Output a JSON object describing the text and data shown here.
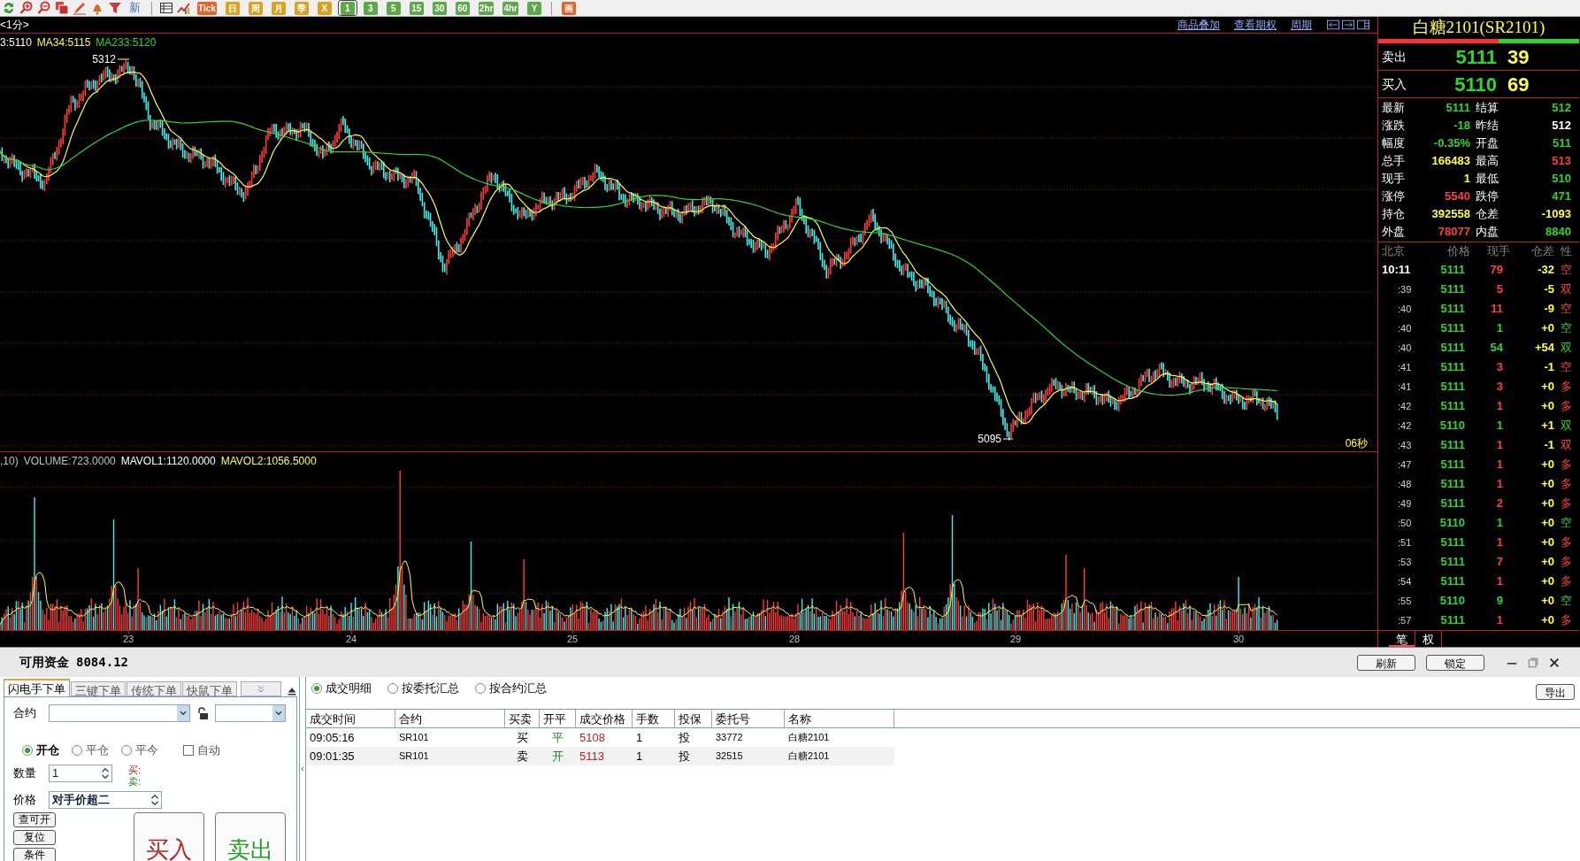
{
  "toolbar": {
    "text_label": "新",
    "tiles": [
      {
        "label": "Tick",
        "color": "#e5632b",
        "selected": false
      },
      {
        "label": "日",
        "color": "#d9a21f",
        "selected": false
      },
      {
        "label": "周",
        "color": "#d9a21f",
        "selected": false
      },
      {
        "label": "月",
        "color": "#d9a21f",
        "selected": false
      },
      {
        "label": "季",
        "color": "#d9a21f",
        "selected": false
      },
      {
        "label": "X",
        "color": "#d9a21f",
        "selected": false
      },
      {
        "label": "1",
        "color": "#5fa84a",
        "selected": true
      },
      {
        "label": "3",
        "color": "#5fa84a",
        "selected": false
      },
      {
        "label": "5",
        "color": "#5fa84a",
        "selected": false
      },
      {
        "label": "15",
        "color": "#5fa84a",
        "selected": false
      },
      {
        "label": "30",
        "color": "#5fa84a",
        "selected": false
      },
      {
        "label": "60",
        "color": "#5fa84a",
        "selected": false
      },
      {
        "label": "2hr",
        "color": "#5fa84a",
        "selected": false
      },
      {
        "label": "4hr",
        "color": "#5fa84a",
        "selected": false
      },
      {
        "label": "Y",
        "color": "#5fa84a",
        "selected": false
      }
    ],
    "end_tiles": [
      {
        "label": "画",
        "color": "#e5632b",
        "selected": false
      }
    ]
  },
  "chart": {
    "period": "<1分>",
    "links": [
      "商品叠加",
      "查看期权",
      "周期"
    ],
    "ma_legend": [
      {
        "text": "3:5110",
        "color": "#ffffff"
      },
      {
        "text": "MA34:5115",
        "color": "#ffff3c"
      },
      {
        "text": "MA233:5120",
        "color": "#2fd52f"
      }
    ],
    "high_label": "5312",
    "low_label": "5095",
    "countdown": "06秒",
    "volume_legend": [
      {
        "text": ",10)",
        "color": "#c0c0c0"
      },
      {
        "text": "VOLUME:723.0000",
        "color": "#c0c0c0"
      },
      {
        "text": "MAVOL1:1120.0000",
        "color": "#ffffff"
      },
      {
        "text": "MAVOL2:1056.5000",
        "color": "#ffff3c"
      }
    ],
    "dates": [
      "23",
      "24",
      "25",
      "28",
      "29",
      "30"
    ]
  },
  "quote": {
    "title": "白糖2101(SR2101)",
    "level": 0.6,
    "ask": {
      "label": "卖出",
      "price": "5111",
      "volume": "39"
    },
    "bid": {
      "label": "买入",
      "price": "5110",
      "volume": "69"
    },
    "stats": [
      {
        "label": "最新",
        "value": "5111",
        "color": "#2fd52f"
      },
      {
        "label": "结算",
        "value": "512",
        "color": "#2fd52f"
      },
      {
        "label": "涨跌",
        "value": "-18",
        "color": "#2fd52f"
      },
      {
        "label": "昨结",
        "value": "512",
        "color": "#ffffff"
      },
      {
        "label": "幅度",
        "value": "-0.35%",
        "color": "#2fd52f"
      },
      {
        "label": "开盘",
        "value": "511",
        "color": "#2fd52f"
      },
      {
        "label": "总手",
        "value": "166483",
        "color": "#ffff3c"
      },
      {
        "label": "最高",
        "value": "513",
        "color": "#ff4040"
      },
      {
        "label": "现手",
        "value": "1",
        "color": "#ffff3c"
      },
      {
        "label": "最低",
        "value": "510",
        "color": "#2fd52f"
      },
      {
        "label": "涨停",
        "value": "5540",
        "color": "#ff4040"
      },
      {
        "label": "跌停",
        "value": "471",
        "color": "#2fd52f"
      },
      {
        "label": "持仓",
        "value": "392558",
        "color": "#ffff3c"
      },
      {
        "label": "仓差",
        "value": "-1093",
        "color": "#ffff3c"
      },
      {
        "label": "外盘",
        "value": "78077",
        "color": "#ff4040"
      },
      {
        "label": "内盘",
        "value": "8840",
        "color": "#2fd52f"
      }
    ],
    "tick_columns": [
      "北京",
      "价格",
      "现手",
      "仓差",
      "性"
    ],
    "ticks": [
      {
        "time": "10:11",
        "price": "5111",
        "volume": "79",
        "diff": "-32",
        "nature": "空",
        "color": "#ff4040"
      },
      {
        "time": ":39",
        "price": "5111",
        "volume": "5",
        "diff": "-5",
        "nature": "双",
        "color": "#ff4040"
      },
      {
        "time": ":40",
        "price": "5111",
        "volume": "11",
        "diff": "-9",
        "nature": "空",
        "color": "#ff4040"
      },
      {
        "time": ":40",
        "price": "5111",
        "volume": "1",
        "diff": "+0",
        "nature": "空",
        "color": "#2fd52f"
      },
      {
        "time": ":40",
        "price": "5111",
        "volume": "54",
        "diff": "+54",
        "nature": "双",
        "color": "#2fd52f"
      },
      {
        "time": ":41",
        "price": "5111",
        "volume": "3",
        "diff": "-1",
        "nature": "空",
        "color": "#ff4040"
      },
      {
        "time": ":41",
        "price": "5111",
        "volume": "3",
        "diff": "+0",
        "nature": "多",
        "color": "#ff4040"
      },
      {
        "time": ":42",
        "price": "5111",
        "volume": "1",
        "diff": "+0",
        "nature": "多",
        "color": "#ff4040"
      },
      {
        "time": ":42",
        "price": "5110",
        "volume": "1",
        "diff": "+1",
        "nature": "双",
        "color": "#2fd52f"
      },
      {
        "time": ":43",
        "price": "5111",
        "volume": "1",
        "diff": "-1",
        "nature": "双",
        "color": "#ff4040"
      },
      {
        "time": ":47",
        "price": "5111",
        "volume": "1",
        "diff": "+0",
        "nature": "多",
        "color": "#ff4040"
      },
      {
        "time": ":48",
        "price": "5111",
        "volume": "1",
        "diff": "+0",
        "nature": "多",
        "color": "#ff4040"
      },
      {
        "time": ":49",
        "price": "5111",
        "volume": "2",
        "diff": "+0",
        "nature": "多",
        "color": "#ff4040"
      },
      {
        "time": ":50",
        "price": "5110",
        "volume": "1",
        "diff": "+0",
        "nature": "空",
        "color": "#2fd52f"
      },
      {
        "time": ":51",
        "price": "5111",
        "volume": "1",
        "diff": "+0",
        "nature": "多",
        "color": "#ff4040"
      },
      {
        "time": ":53",
        "price": "5111",
        "volume": "7",
        "diff": "+0",
        "nature": "多",
        "color": "#ff4040"
      },
      {
        "time": ":54",
        "price": "5111",
        "volume": "1",
        "diff": "+0",
        "nature": "多",
        "color": "#ff4040"
      },
      {
        "time": ":55",
        "price": "5110",
        "volume": "9",
        "diff": "+0",
        "nature": "空",
        "color": "#2fd52f"
      },
      {
        "time": ":57",
        "price": "5111",
        "volume": "1",
        "diff": "+0",
        "nature": "多",
        "color": "#ff4040"
      }
    ],
    "tabs": [
      {
        "label": "笔",
        "selected": true
      },
      {
        "label": "权",
        "selected": false
      }
    ]
  },
  "trade_panel": {
    "funds_label": "可用资金",
    "funds_value": "8084.12",
    "buttons": [
      "刷新",
      "锁定"
    ],
    "order_tabs": [
      {
        "label": "闪电手下单",
        "selected": true
      },
      {
        "label": "三键下单",
        "selected": false
      },
      {
        "label": "传统下单",
        "selected": false
      },
      {
        "label": "快鼠下单",
        "selected": false
      }
    ],
    "contract_label": "合约",
    "offset_options": [
      {
        "label": "开仓",
        "selected": true
      },
      {
        "label": "平仓",
        "selected": false
      },
      {
        "label": "平今",
        "selected": false
      }
    ],
    "auto": {
      "label": "自动",
      "checked": false
    },
    "quantity_label": "数量",
    "quantity": "1",
    "buy_hint": "买:",
    "sell_hint": "卖:",
    "price_label": "价格",
    "price_mode": "对手价超二",
    "side_buttons": [
      "查可开",
      "复位",
      "条件"
    ],
    "buy_button": "买入",
    "sell_button": "卖出",
    "views": [
      {
        "label": "成交明细",
        "selected": true
      },
      {
        "label": "按委托汇总",
        "selected": false
      },
      {
        "label": "按合约汇总",
        "selected": false
      }
    ],
    "export_button": "导出",
    "columns": [
      "成交时间",
      "合约",
      "买卖",
      "开平",
      "成交价格",
      "手数",
      "投保",
      "委托号",
      "名称"
    ],
    "rows": [
      [
        "09:05:16",
        "SR101",
        "买",
        "平",
        "5108",
        "1",
        "投",
        "33772",
        "白糖2101"
      ],
      [
        "09:01:35",
        "SR101",
        "卖",
        "开",
        "5113",
        "1",
        "投",
        "32515",
        "白糖2101"
      ]
    ]
  }
}
